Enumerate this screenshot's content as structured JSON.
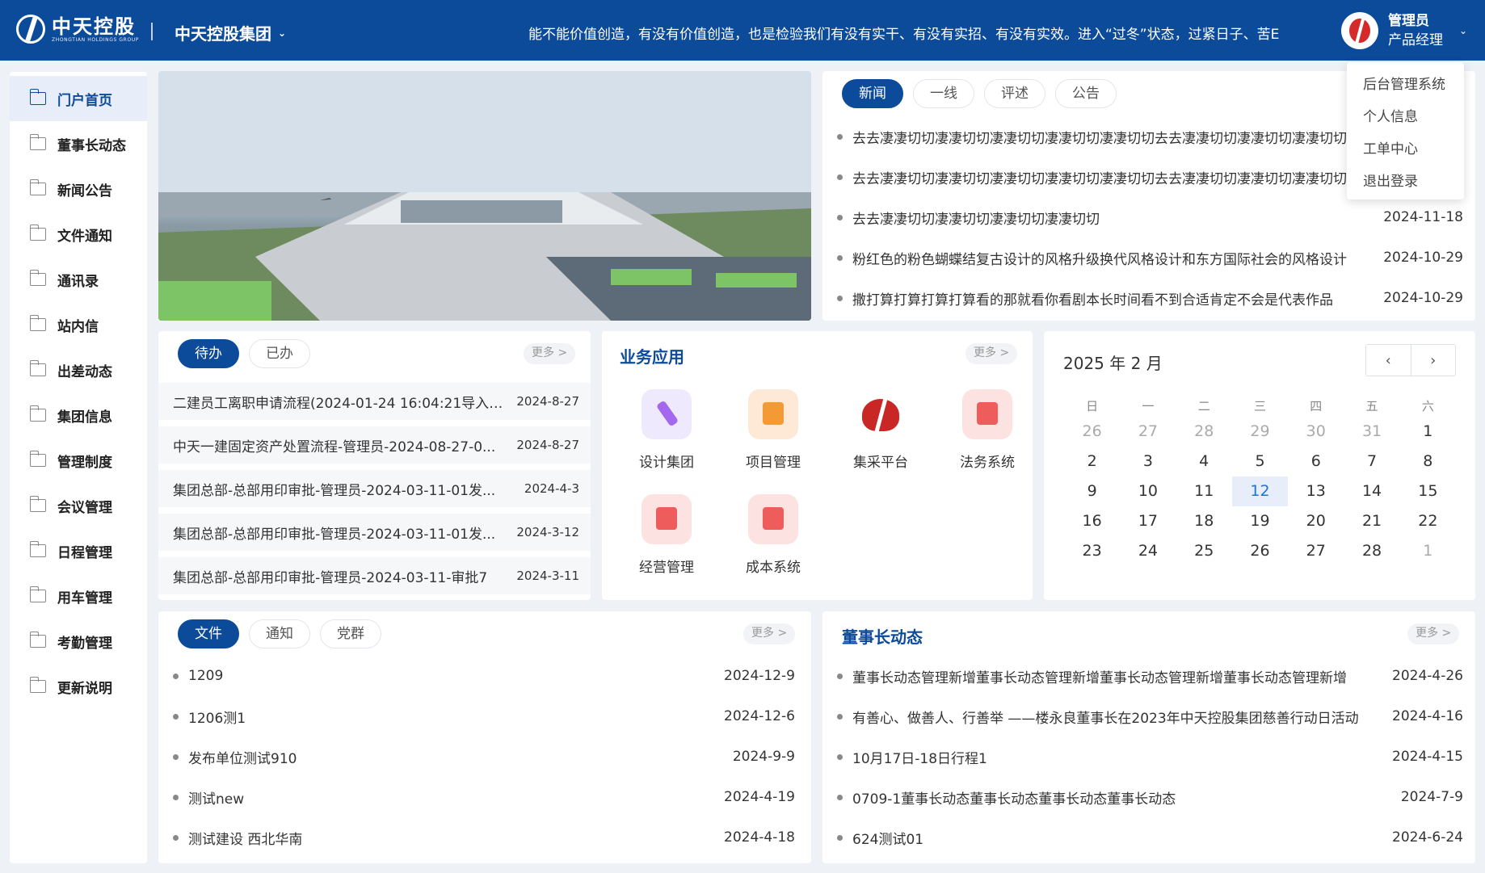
{
  "header": {
    "logo_cn": "中天控股",
    "logo_en": "ZHONGTIAN HOLDINGS GROUP",
    "org_name": "中天控股集团",
    "marquee": "能不能价值创造，有没有价值创造，也是检验我们有没有实干、有没有实招、有没有实效。进入“过冬”状态，过紧日子、苦E",
    "user_name": "管理员",
    "user_role": "产品经理"
  },
  "user_menu": [
    "后台管理系统",
    "个人信息",
    "工单中心",
    "退出登录"
  ],
  "sidebar": {
    "items": [
      "门户首页",
      "董事长动态",
      "新闻公告",
      "文件通知",
      "通讯录",
      "站内信",
      "出差动态",
      "集团信息",
      "管理制度",
      "会议管理",
      "日程管理",
      "用车管理",
      "考勤管理",
      "更新说明"
    ]
  },
  "news": {
    "tabs": [
      "新闻",
      "一线",
      "评述",
      "公告"
    ],
    "items": [
      {
        "title": "去去凄凄切切凄凄切切凄凄切切凄凄切切凄凄切切去去凄凄切切凄凄切切凄凄切切",
        "date": ""
      },
      {
        "title": "去去凄凄切切凄凄切切凄凄切切凄凄切切凄凄切切去去凄凄切切凄凄切切凄凄切切",
        "date": ""
      },
      {
        "title": "去去凄凄切切凄凄切切凄凄切切凄凄切切",
        "date": "2024-11-18"
      },
      {
        "title": "粉红色的粉色蝴蝶结复古设计的风格升级换代风格设计和东方国际社会的风格设计",
        "date": "2024-10-29"
      },
      {
        "title": "撒打算打算打算打算看的那就看你看剧本长时间看不到合适肯定不会是代表作品",
        "date": "2024-10-29"
      }
    ]
  },
  "todo": {
    "tabs": [
      "待办",
      "已办"
    ],
    "more": "更多 >",
    "items": [
      {
        "title": "二建员工离职申请流程(2024-01-24 16:04:21导入)...",
        "date": "2024-8-27"
      },
      {
        "title": "中天一建固定资产处置流程-管理员-2024-08-27-0...",
        "date": "2024-8-27"
      },
      {
        "title": "集团总部-总部用印审批-管理员-2024-03-11-01发...",
        "date": "2024-4-3"
      },
      {
        "title": "集团总部-总部用印审批-管理员-2024-03-11-01发...",
        "date": "2024-3-12"
      },
      {
        "title": "集团总部-总部用印审批-管理员-2024-03-11-审批7",
        "date": "2024-3-11"
      }
    ]
  },
  "apps": {
    "title": "业务应用",
    "more": "更多 >",
    "items": [
      {
        "label": "设计集团",
        "icon": "design-icon"
      },
      {
        "label": "项目管理",
        "icon": "project-icon"
      },
      {
        "label": "集采平台",
        "icon": "procurement-logo-icon"
      },
      {
        "label": "法务系统",
        "icon": "legal-icon"
      },
      {
        "label": "经营管理",
        "icon": "operation-icon"
      },
      {
        "label": "成本系统",
        "icon": "cost-icon"
      }
    ]
  },
  "calendar": {
    "title": "2025 年 2 月",
    "weekdays": [
      "日",
      "一",
      "二",
      "三",
      "四",
      "五",
      "六"
    ],
    "weeks": [
      [
        "26",
        "27",
        "28",
        "29",
        "30",
        "31",
        "1"
      ],
      [
        "2",
        "3",
        "4",
        "5",
        "6",
        "7",
        "8"
      ],
      [
        "9",
        "10",
        "11",
        "12",
        "13",
        "14",
        "15"
      ],
      [
        "16",
        "17",
        "18",
        "19",
        "20",
        "21",
        "22"
      ],
      [
        "23",
        "24",
        "25",
        "26",
        "27",
        "28",
        "1"
      ]
    ],
    "today": "12"
  },
  "files": {
    "tabs": [
      "文件",
      "通知",
      "党群"
    ],
    "more": "更多 >",
    "items": [
      {
        "title": "1209",
        "date": "2024-12-9"
      },
      {
        "title": "1206测1",
        "date": "2024-12-6"
      },
      {
        "title": "发布单位测试910",
        "date": "2024-9-9"
      },
      {
        "title": "测试new",
        "date": "2024-4-19"
      },
      {
        "title": "测试建设 西北华南",
        "date": "2024-4-18"
      }
    ]
  },
  "chairman": {
    "title": "董事长动态",
    "more": "更多 >",
    "items": [
      {
        "title": "董事长动态管理新增董事长动态管理新增董事长动态管理新增董事长动态管理新增",
        "date": "2024-4-26"
      },
      {
        "title": "有善心、做善人、行善举 ——楼永良董事长在2023年中天控股集团慈善行动日活动",
        "date": "2024-4-16"
      },
      {
        "title": "10月17日-18日行程1",
        "date": "2024-4-15"
      },
      {
        "title": "0709-1董事长动态董事长动态董事长动态董事长动态",
        "date": "2024-7-9"
      },
      {
        "title": "624测试01",
        "date": "2024-6-24"
      }
    ]
  }
}
